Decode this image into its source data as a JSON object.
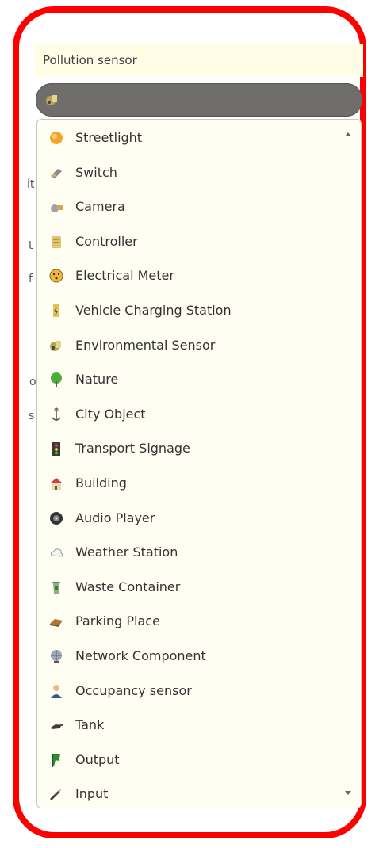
{
  "header": {
    "label": "Pollution sensor"
  },
  "combo": {
    "icon": "environmental-sensor-icon"
  },
  "items": [
    {
      "label": "Streetlight",
      "icon": "streetlight-icon"
    },
    {
      "label": "Switch",
      "icon": "switch-icon"
    },
    {
      "label": "Camera",
      "icon": "camera-icon"
    },
    {
      "label": "Controller",
      "icon": "controller-icon"
    },
    {
      "label": "Electrical Meter",
      "icon": "electrical-meter-icon"
    },
    {
      "label": "Vehicle Charging Station",
      "icon": "vehicle-charging-station-icon"
    },
    {
      "label": "Environmental Sensor",
      "icon": "environmental-sensor-icon"
    },
    {
      "label": "Nature",
      "icon": "nature-icon"
    },
    {
      "label": "City Object",
      "icon": "city-object-icon"
    },
    {
      "label": "Transport Signage",
      "icon": "transport-signage-icon"
    },
    {
      "label": "Building",
      "icon": "building-icon"
    },
    {
      "label": "Audio Player",
      "icon": "audio-player-icon"
    },
    {
      "label": "Weather Station",
      "icon": "weather-station-icon"
    },
    {
      "label": "Waste Container",
      "icon": "waste-container-icon"
    },
    {
      "label": "Parking Place",
      "icon": "parking-place-icon"
    },
    {
      "label": "Network Component",
      "icon": "network-component-icon"
    },
    {
      "label": "Occupancy sensor",
      "icon": "occupancy-sensor-icon"
    },
    {
      "label": "Tank",
      "icon": "tank-icon"
    },
    {
      "label": "Output",
      "icon": "output-icon"
    },
    {
      "label": "Input",
      "icon": "input-icon"
    }
  ],
  "background_fragments": [
    "it",
    "t",
    "f",
    "o",
    "s"
  ],
  "colors": {
    "frame": "#ff0000",
    "combo_bg": "#6f6e6b",
    "list_bg": "#fffef2",
    "header_bg": "#fffde6"
  }
}
